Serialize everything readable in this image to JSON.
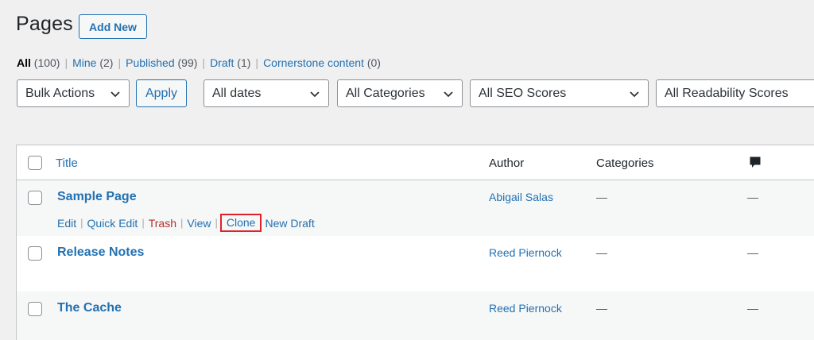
{
  "header": {
    "title": "Pages",
    "add_new_label": "Add New"
  },
  "filters": {
    "views": [
      {
        "label": "All",
        "count": "(100)",
        "current": true
      },
      {
        "label": "Mine",
        "count": "(2)"
      },
      {
        "label": "Published",
        "count": "(99)"
      },
      {
        "label": "Draft",
        "count": "(1)"
      },
      {
        "label": "Cornerstone content",
        "count": "(0)"
      }
    ],
    "bulk_actions": "Bulk Actions",
    "apply_label": "Apply",
    "dates": "All dates",
    "categories": "All Categories",
    "seo_scores": "All SEO Scores",
    "readability_scores": "All Readability Scores"
  },
  "table": {
    "columns": {
      "title": "Title",
      "author": "Author",
      "categories": "Categories",
      "comments_icon": "comment-icon"
    },
    "rows": [
      {
        "title": "Sample Page",
        "author": "Abigail Salas",
        "categories": "—",
        "comments": "—"
      },
      {
        "title": "Release Notes",
        "author": "Reed Piernock",
        "categories": "—",
        "comments": "—"
      },
      {
        "title": "The Cache",
        "author": "Reed Piernock",
        "categories": "—",
        "comments": "—"
      }
    ],
    "row_actions": {
      "edit": "Edit",
      "quick_edit": "Quick Edit",
      "trash": "Trash",
      "view": "View",
      "clone": "Clone",
      "new_draft": "New Draft",
      "separator": "|"
    }
  },
  "colors": {
    "link": "#2271b1",
    "trash": "#b32d2e",
    "highlight": "#e0232b",
    "background": "#f0f0f1"
  }
}
